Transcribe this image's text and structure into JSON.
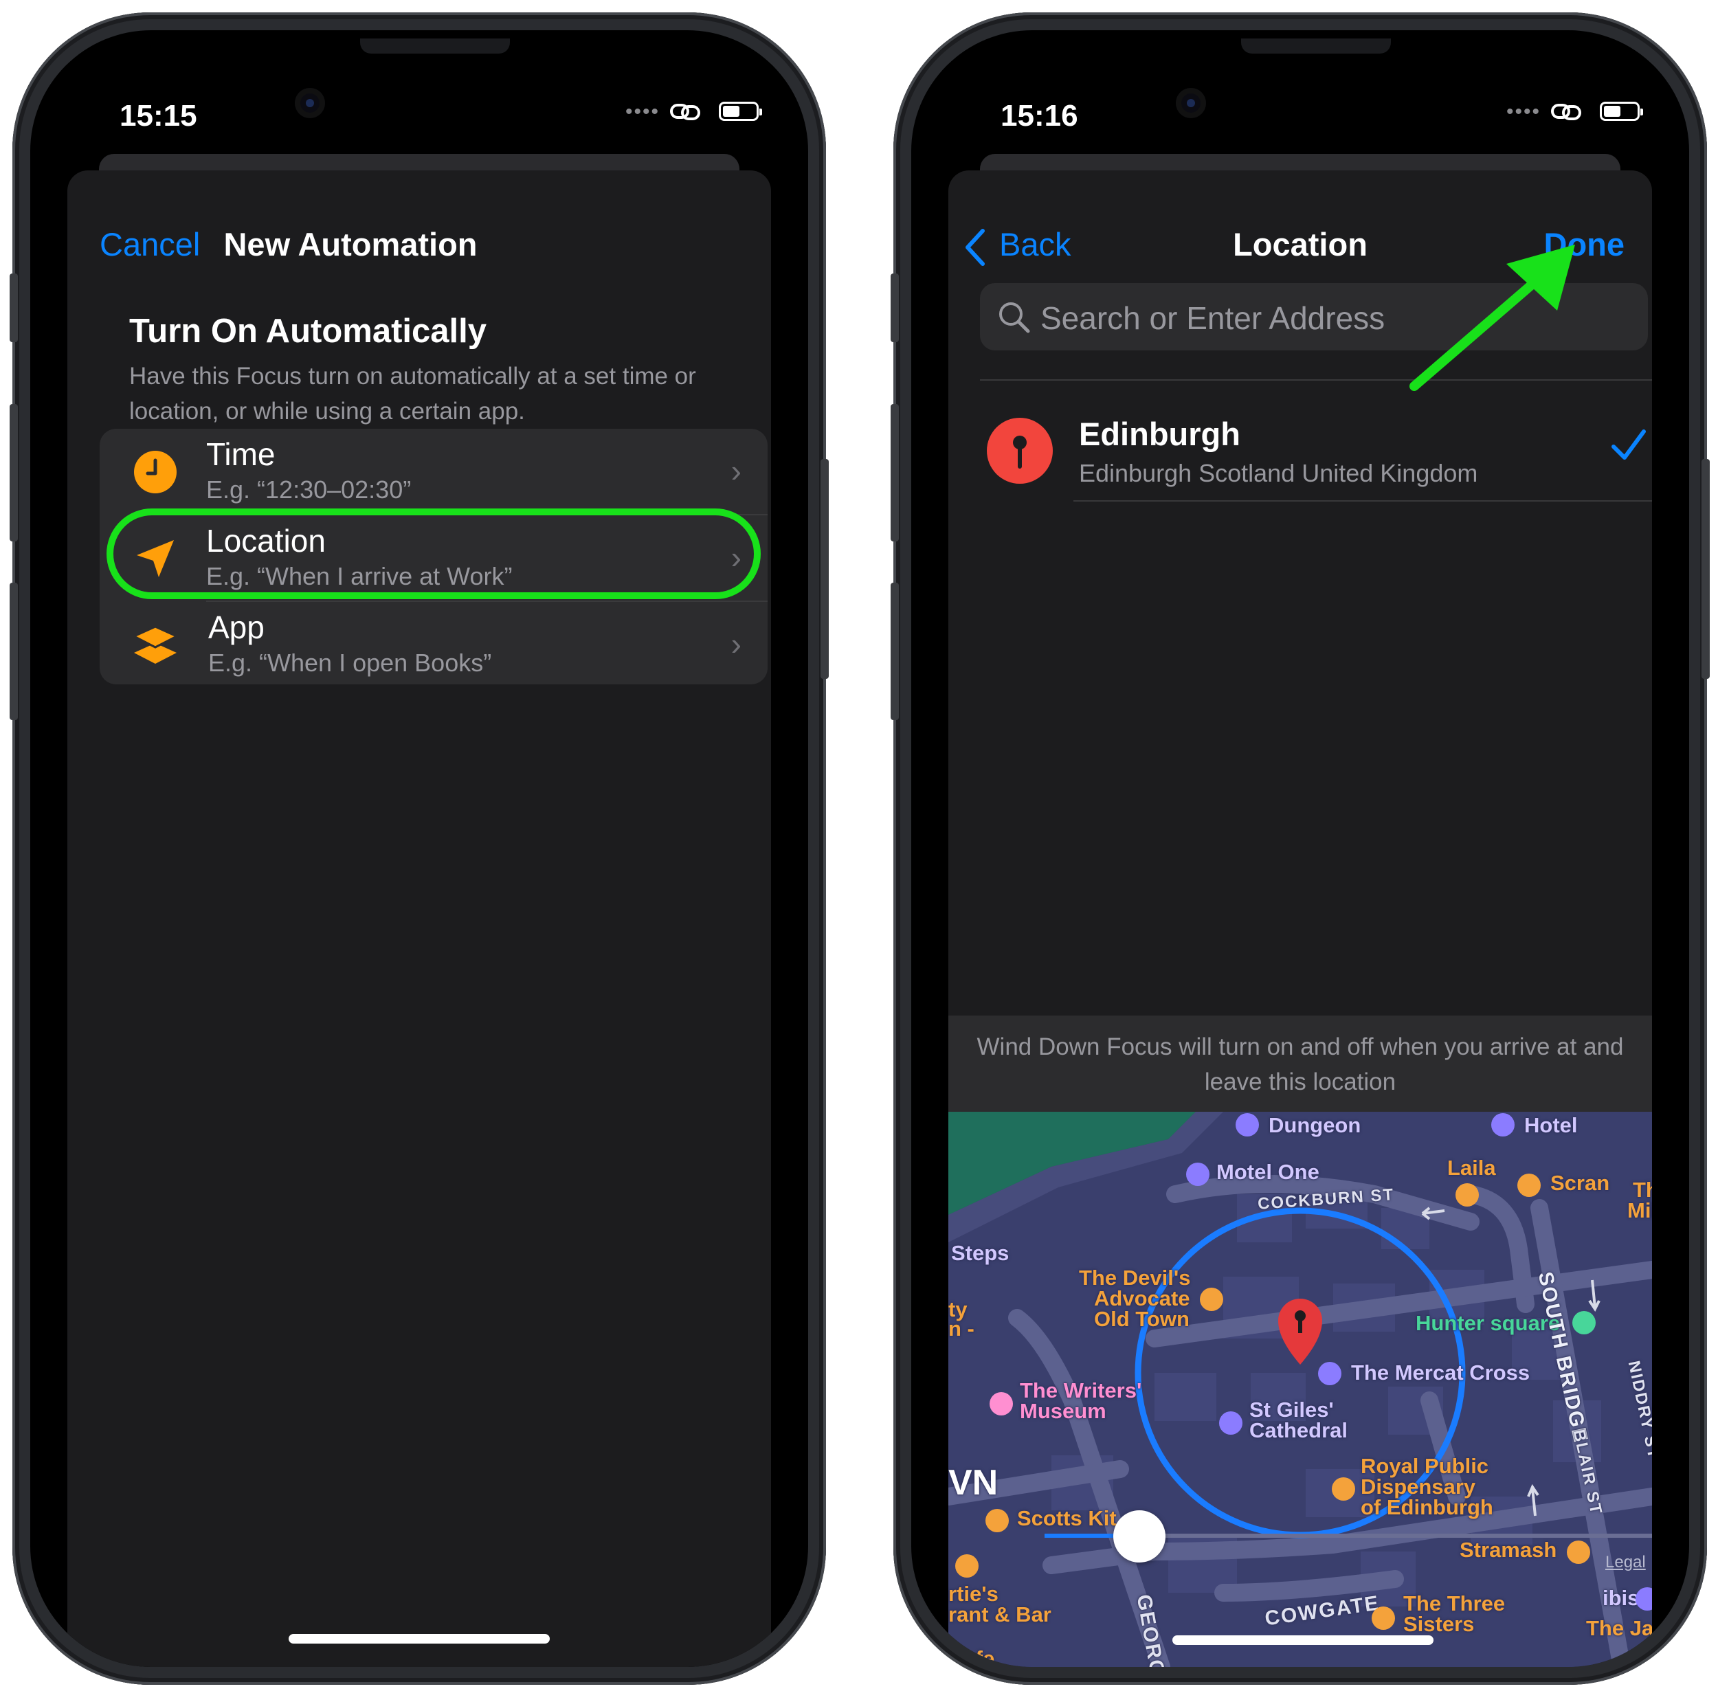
{
  "left_phone": {
    "status": {
      "time": "15:15"
    },
    "nav": {
      "cancel": "Cancel",
      "title": "New Automation"
    },
    "section": {
      "title": "Turn On Automatically",
      "description": "Have this Focus turn on automatically at a set time or location, or while using a certain app."
    },
    "options": [
      {
        "title": "Time",
        "subtitle": "E.g. “12:30–02:30”",
        "icon": "clock-icon"
      },
      {
        "title": "Location",
        "subtitle": "E.g. “When I arrive at Work”",
        "icon": "location-arrow-icon",
        "highlighted": true
      },
      {
        "title": "App",
        "subtitle": "E.g. “When I open Books”",
        "icon": "app-layers-icon"
      }
    ],
    "highlight_color": "#18e11a"
  },
  "right_phone": {
    "status": {
      "time": "15:16"
    },
    "nav": {
      "back": "Back",
      "title": "Location",
      "done": "Done"
    },
    "search": {
      "placeholder": "Search or Enter Address"
    },
    "selected_place": {
      "name": "Edinburgh",
      "address": "Edinburgh Scotland United Kingdom",
      "selected": true
    },
    "info_text": "Wind Down Focus will turn on and off when you arrive at and leave this location",
    "map": {
      "radius_slider_value": 0.3,
      "labels": {
        "dungeon": "Dungeon",
        "hotel": "Hotel",
        "motel_one": "Motel One",
        "laila": "Laila",
        "scran": "Scran",
        "the_mile_1": "The I",
        "the_mile_2": "Mile T",
        "cockburn_st": "COCKBURN ST",
        "steps": "Steps",
        "devils_1": "The Devil's",
        "devils_2": "Advocate",
        "devils_3": "Old Town",
        "ty": "ty",
        "n_dash": "n -",
        "hunter_square": "Hunter square",
        "south_bridge": "SOUTH BRIDGE",
        "mercat_cross": "The Mercat Cross",
        "writers_1": "The Writers'",
        "writers_2": "Museum",
        "st_giles_1": "St Giles'",
        "st_giles_2": "Cathedral",
        "niddry_st": "NIDDRY ST",
        "blair_st": "BLAIR ST",
        "wn": "VN",
        "royal_1": "Royal Public",
        "royal_2": "Dispensary",
        "royal_3": "of Edinburgh",
        "scotts": "Scotts Kit",
        "stramash": "Stramash",
        "legal": "Legal",
        "berties_1": "rtie's",
        "berties_2": "rant & Bar",
        "cowgate": "COWGATE",
        "three_sisters_1": "The Three",
        "three_sisters_2": "Sisters",
        "ibis": "ibis",
        "the_jaz": "The Jaz",
        "cafe": "Cafe",
        "george": "GEORG"
      }
    }
  },
  "annotation_arrow_color": "#18e11a"
}
